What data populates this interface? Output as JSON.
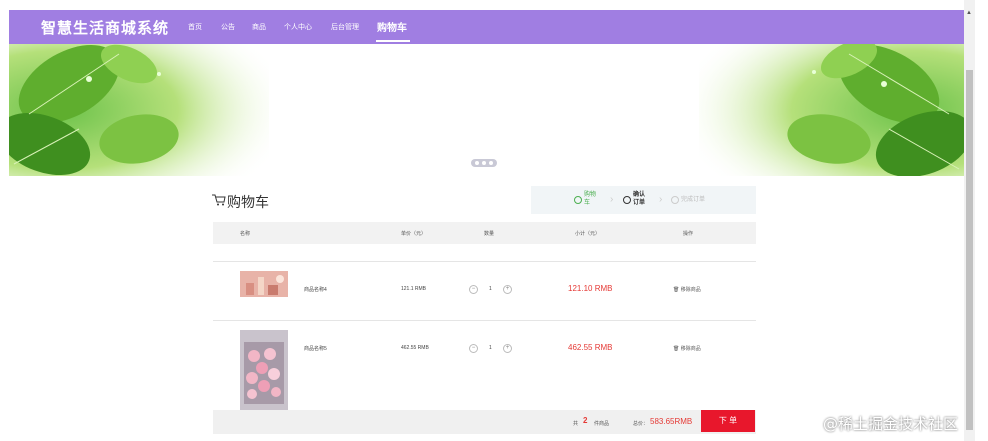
{
  "header": {
    "brand": "智慧生活商城系统",
    "nav": [
      {
        "label": "首页"
      },
      {
        "label": "公告"
      },
      {
        "label": "商品"
      },
      {
        "label": "个人中心"
      },
      {
        "label": "后台管理"
      },
      {
        "label": "购物车"
      }
    ]
  },
  "cart": {
    "title": "购物车",
    "steps": [
      {
        "label": "购物车",
        "color": "#4caf50"
      },
      {
        "label": "确认订单",
        "color": "#333333"
      },
      {
        "label": "完成订单",
        "color": "#bbbbbb"
      }
    ],
    "columns": [
      "名称",
      "单价（元）",
      "数量",
      "小计（元）",
      "操作"
    ],
    "items": [
      {
        "name": "商品名称4",
        "price": "121.1 RMB",
        "qty": "1",
        "subtotal": "121.10 RMB",
        "action": "移除商品"
      },
      {
        "name": "商品名称5",
        "price": "462.55 RMB",
        "qty": "1",
        "subtotal": "462.55 RMB",
        "action": "移除商品"
      }
    ],
    "footer": {
      "count_prefix": "共",
      "count": "2",
      "count_suffix": "件商品",
      "total_label": "总价：",
      "total": "583.65RMB",
      "order_button": "下 单"
    }
  },
  "watermark": "@稀土掘金技术社区",
  "colors": {
    "nav": "#a07ee2",
    "accent_red": "#e8172c"
  }
}
